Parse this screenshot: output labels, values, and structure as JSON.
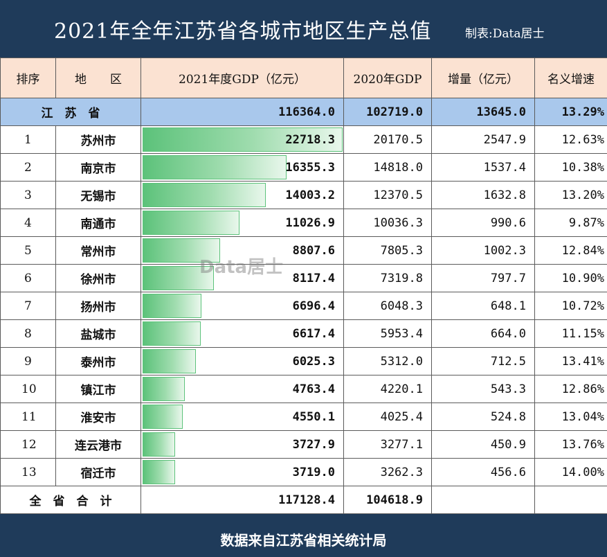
{
  "title": "2021年全年江苏省各城市地区生产总值",
  "maker": "制表:Data居士",
  "watermark": "Data居士",
  "footer": "数据来自江苏省相关统计局",
  "headers": {
    "rank": "排序",
    "region": "地　　区",
    "gdp2021": "2021年度GDP（亿元）",
    "gdp2020": "2020年GDP",
    "increase": "增量（亿元）",
    "growth": "名义增速"
  },
  "province": {
    "name": "江　苏　省",
    "gdp2021": "116364.0",
    "gdp2020": "102719.0",
    "increase": "13645.0",
    "growth": "13.29%"
  },
  "total": {
    "label": "全　省　合　计",
    "gdp2021": "117128.4",
    "gdp2020": "104618.9"
  },
  "colors": {
    "header_bg": "#1f3b5a",
    "column_header_bg": "#fbe2d2",
    "province_row_bg": "#a9c8ec",
    "bar": "#5cc27a"
  },
  "chart_data": {
    "type": "table",
    "columns": [
      "排序",
      "地　　区",
      "2021年度GDP（亿元）",
      "2020年GDP",
      "增量（亿元）",
      "名义增速"
    ],
    "bar_column": "2021年度GDP（亿元）",
    "bar_max": 22718.3,
    "rows": [
      {
        "rank": "1",
        "city": "苏州市",
        "gdp2021": 22718.3,
        "gdp2021_text": "22718.3",
        "gdp2020": "20170.5",
        "increase": "2547.9",
        "growth": "12.63%"
      },
      {
        "rank": "2",
        "city": "南京市",
        "gdp2021": 16355.3,
        "gdp2021_text": "16355.3",
        "gdp2020": "14818.0",
        "increase": "1537.4",
        "growth": "10.38%"
      },
      {
        "rank": "3",
        "city": "无锡市",
        "gdp2021": 14003.2,
        "gdp2021_text": "14003.2",
        "gdp2020": "12370.5",
        "increase": "1632.8",
        "growth": "13.20%"
      },
      {
        "rank": "4",
        "city": "南通市",
        "gdp2021": 11026.9,
        "gdp2021_text": "11026.9",
        "gdp2020": "10036.3",
        "increase": "990.6",
        "growth": "9.87%"
      },
      {
        "rank": "5",
        "city": "常州市",
        "gdp2021": 8807.6,
        "gdp2021_text": "8807.6",
        "gdp2020": "7805.3",
        "increase": "1002.3",
        "growth": "12.84%"
      },
      {
        "rank": "6",
        "city": "徐州市",
        "gdp2021": 8117.4,
        "gdp2021_text": "8117.4",
        "gdp2020": "7319.8",
        "increase": "797.7",
        "growth": "10.90%"
      },
      {
        "rank": "7",
        "city": "扬州市",
        "gdp2021": 6696.4,
        "gdp2021_text": "6696.4",
        "gdp2020": "6048.3",
        "increase": "648.1",
        "growth": "10.72%"
      },
      {
        "rank": "8",
        "city": "盐城市",
        "gdp2021": 6617.4,
        "gdp2021_text": "6617.4",
        "gdp2020": "5953.4",
        "increase": "664.0",
        "growth": "11.15%"
      },
      {
        "rank": "9",
        "city": "泰州市",
        "gdp2021": 6025.3,
        "gdp2021_text": "6025.3",
        "gdp2020": "5312.0",
        "increase": "712.5",
        "growth": "13.41%"
      },
      {
        "rank": "10",
        "city": "镇江市",
        "gdp2021": 4763.4,
        "gdp2021_text": "4763.4",
        "gdp2020": "4220.1",
        "increase": "543.3",
        "growth": "12.86%"
      },
      {
        "rank": "11",
        "city": "淮安市",
        "gdp2021": 4550.1,
        "gdp2021_text": "4550.1",
        "gdp2020": "4025.4",
        "increase": "524.8",
        "growth": "13.04%"
      },
      {
        "rank": "12",
        "city": "连云港市",
        "gdp2021": 3727.9,
        "gdp2021_text": "3727.9",
        "gdp2020": "3277.1",
        "increase": "450.9",
        "growth": "13.76%"
      },
      {
        "rank": "13",
        "city": "宿迁市",
        "gdp2021": 3719.0,
        "gdp2021_text": "3719.0",
        "gdp2020": "3262.3",
        "increase": "456.6",
        "growth": "14.00%"
      }
    ]
  }
}
